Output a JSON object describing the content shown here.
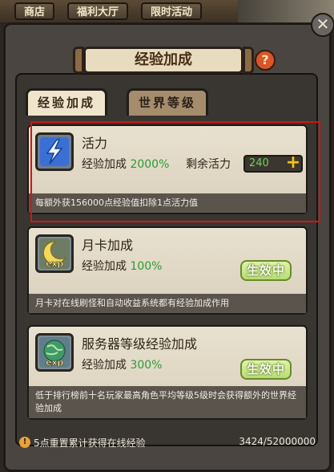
{
  "top_tabs": [
    "商店",
    "福利大厅",
    "限时活动"
  ],
  "title": "经验加成",
  "tabs": [
    {
      "label": "经验加成",
      "active": true
    },
    {
      "label": "世界等级",
      "active": false
    }
  ],
  "cards": [
    {
      "title": "活力",
      "bonus_label": "经验加成",
      "bonus_value": "2000%",
      "stamina_label": "剩余活力",
      "stamina_value": "240",
      "desc": "每额外获156000点经验值扣除1点活力值"
    },
    {
      "title": "月卡加成",
      "bonus_label": "经验加成",
      "bonus_value": "100%",
      "status": "生效中",
      "icon_text": "exp",
      "desc": "月卡对在线刷怪和自动收益系统都有经验加成作用"
    },
    {
      "title": "服务器等级经验加成",
      "bonus_label": "经验加成",
      "bonus_value": "300%",
      "status": "生效中",
      "icon_text": "exp",
      "desc": "低于排行榜前十名玩家最高角色平均等级5级时会获得额外的世界经验加成"
    }
  ],
  "footer": {
    "text": "5点重置累计获得在线经验",
    "progress": "3424/52000000"
  },
  "icons": {
    "close": "close-icon",
    "help": "question-icon",
    "plus": "plus-icon",
    "lightning": "lightning-icon",
    "moon": "moon-icon",
    "globe": "globe-icon",
    "warn": "warning-icon"
  },
  "colors": {
    "bonus_green": "#2e9b34",
    "highlight_red": "#d21515",
    "stamina_green": "#6bd25a"
  }
}
